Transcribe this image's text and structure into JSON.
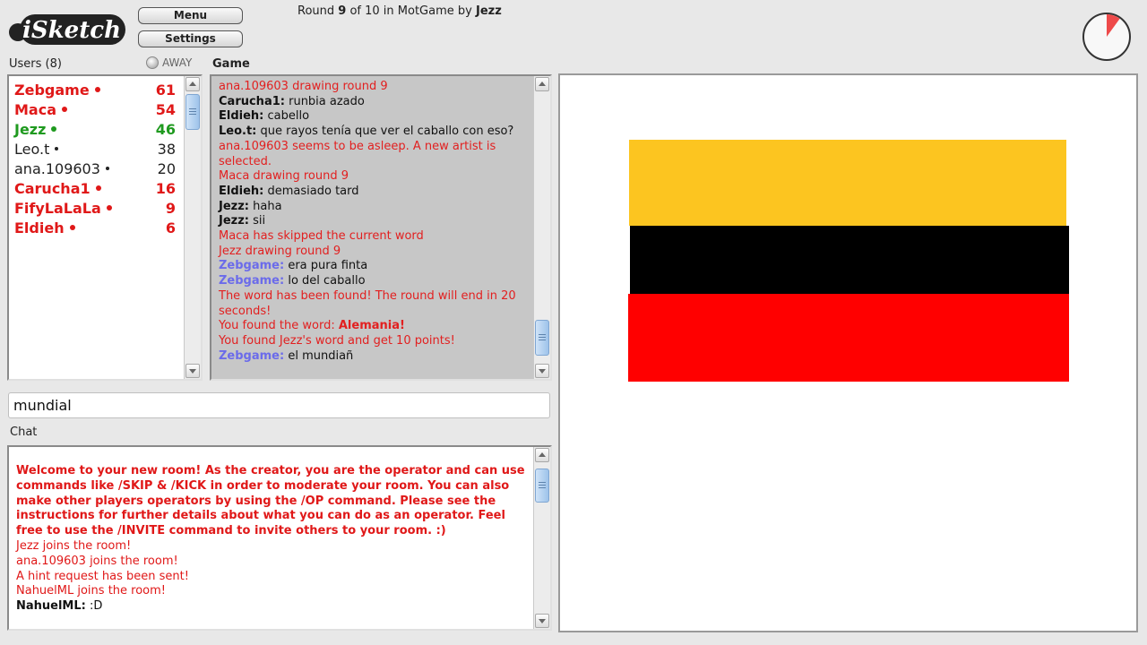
{
  "app": {
    "logo_text": "iSketch",
    "menu_label": "Menu",
    "settings_label": "Settings"
  },
  "round": {
    "prefix": "Round",
    "current": "9",
    "of_text": "of 10 in MotGame by",
    "host": "Jezz",
    "timer_fraction_remaining": 0.9
  },
  "users": {
    "header": "Users (8)",
    "away_label": "AWAY",
    "list": [
      {
        "name": "Zebgame",
        "score": "61",
        "style": "red"
      },
      {
        "name": "Maca",
        "score": "54",
        "style": "red"
      },
      {
        "name": "Jezz",
        "score": "46",
        "style": "green"
      },
      {
        "name": "Leo.t",
        "score": "38",
        "style": "plain"
      },
      {
        "name": "ana.109603",
        "score": "20",
        "style": "plain"
      },
      {
        "name": "Carucha1",
        "score": "16",
        "style": "red"
      },
      {
        "name": "FifyLaLaLa",
        "score": "9",
        "style": "red"
      },
      {
        "name": "Eldieh",
        "score": "6",
        "style": "red"
      }
    ]
  },
  "game": {
    "header": "Game",
    "log": [
      {
        "type": "sys",
        "text": "ana.109603 drawing round 9"
      },
      {
        "type": "msg",
        "who": "Carucha1:",
        "text": "runbia azado"
      },
      {
        "type": "msg",
        "who": "Eldieh:",
        "text": "cabello"
      },
      {
        "type": "msg",
        "who": "Leo.t:",
        "text": "que rayos tenía que ver el caballo con eso?"
      },
      {
        "type": "sys",
        "text": "ana.109603 seems to be asleep. A new artist is selected."
      },
      {
        "type": "sys",
        "text": "Maca drawing round 9"
      },
      {
        "type": "msg",
        "who": "Eldieh:",
        "text": "demasiado tard"
      },
      {
        "type": "msg",
        "who": "Jezz:",
        "text": "haha"
      },
      {
        "type": "msg",
        "who": "Jezz:",
        "text": "sii"
      },
      {
        "type": "sys",
        "text": "Maca has skipped the current word"
      },
      {
        "type": "sys",
        "text": "Jezz drawing round 9"
      },
      {
        "type": "msgblue",
        "who": "Zebgame:",
        "text": "era pura finta"
      },
      {
        "type": "msgblue",
        "who": "Zebgame:",
        "text": "lo del caballo"
      },
      {
        "type": "sys",
        "text": "The word has been found! The round will end in 20 seconds!"
      },
      {
        "type": "found",
        "text": "You found the word:",
        "word": "Alemania!"
      },
      {
        "type": "sys",
        "text": "You found Jezz's word and get 10 points!"
      },
      {
        "type": "msgblue",
        "who": "Zebgame:",
        "text": "el mundiañ"
      }
    ]
  },
  "guess": {
    "value": "mundial"
  },
  "chat": {
    "header": "Chat",
    "log": [
      {
        "type": "sysb",
        "text": "Welcome to your new room! As the creator, you are the operator and can use commands like /SKIP & /KICK in order to moderate your room. You can also make other players operators by using the /OP command. Please see the instructions for further details about what you can do as an operator. Feel free to use the /INVITE command to invite others to your room. :)"
      },
      {
        "type": "sys",
        "text": "Jezz joins the room!"
      },
      {
        "type": "sys",
        "text": "ana.109603 joins the room!"
      },
      {
        "type": "sys",
        "text": "A hint request has been sent!"
      },
      {
        "type": "sys",
        "text": "NahuelML joins the room!"
      },
      {
        "type": "msg",
        "who": "NahuelML:",
        "text": ":D"
      }
    ]
  },
  "drawing": {
    "stripes": [
      "#fcc520",
      "#000000",
      "#ff0000"
    ]
  }
}
